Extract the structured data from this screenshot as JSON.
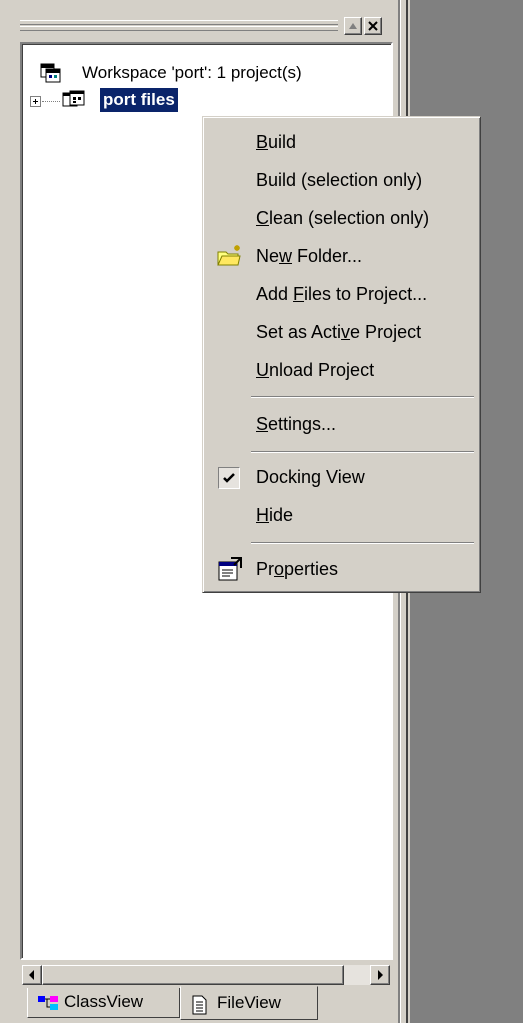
{
  "workspace": {
    "label": "Workspace 'port': 1 project(s)",
    "project_label": "port files"
  },
  "tabs": [
    {
      "label": "ClassView"
    },
    {
      "label": "FileView"
    }
  ],
  "menu": {
    "items": [
      {
        "prefix": "",
        "key": "B",
        "rest": "uild"
      },
      {
        "prefix": "Build (selection only)",
        "key": "",
        "rest": ""
      },
      {
        "prefix": "",
        "key": "C",
        "rest": "lean (selection only)"
      },
      {
        "prefix": "Ne",
        "key": "w",
        "rest": " Folder..."
      },
      {
        "prefix": "Add ",
        "key": "F",
        "rest": "iles to Project..."
      },
      {
        "prefix": "Set as Acti",
        "key": "v",
        "rest": "e Project"
      },
      {
        "prefix": "",
        "key": "U",
        "rest": "nload Project"
      },
      {
        "prefix": "",
        "key": "S",
        "rest": "ettings..."
      },
      {
        "prefix": "Docking View",
        "key": "",
        "rest": ""
      },
      {
        "prefix": "",
        "key": "H",
        "rest": "ide"
      },
      {
        "prefix": "Pr",
        "key": "o",
        "rest": "perties"
      }
    ]
  },
  "colors": {
    "face": "#d4d0c8",
    "selection": "#0a246a",
    "dark_gray": "#808080"
  },
  "icons": [
    "workspace-icon",
    "project-icon",
    "new-folder-icon",
    "checkmark-icon",
    "properties-icon",
    "classview-icon",
    "fileview-icon",
    "close-icon",
    "restore-icon",
    "arrow-left-icon",
    "arrow-right-icon"
  ]
}
